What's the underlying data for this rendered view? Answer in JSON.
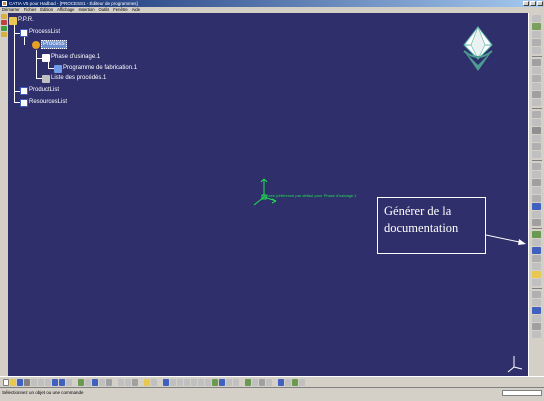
{
  "window": {
    "title": "CATIA V5 pour Hadbad - [PROCESS1 - Éditeur de programmes]"
  },
  "menu": {
    "items": [
      "Démarrer",
      "Fichier",
      "Édition",
      "Affichage",
      "Insertion",
      "Outils",
      "Fenêtre",
      "Aide"
    ]
  },
  "tree": {
    "root": "P.P.R.",
    "process_list": "ProcessList",
    "process": "Process",
    "phase": "Phase d'usinage.1",
    "program": "Programme de fabrication.1",
    "procedures": "Liste des procédés.1",
    "product_list": "ProductList",
    "resources_list": "ResourcesList"
  },
  "canvas": {
    "axis_label": "Axes (référence par défaut pour Phase d'usinage.1",
    "background_color": "#2f2f6b"
  },
  "annotation": {
    "text": "Générer de la documentation"
  },
  "status": {
    "text": "Sélectionnez un objet ou une commande"
  },
  "colors": {
    "tree_text": "#ffffff",
    "selection": "#6c8ccb",
    "axis_green": "#1fe04d"
  }
}
